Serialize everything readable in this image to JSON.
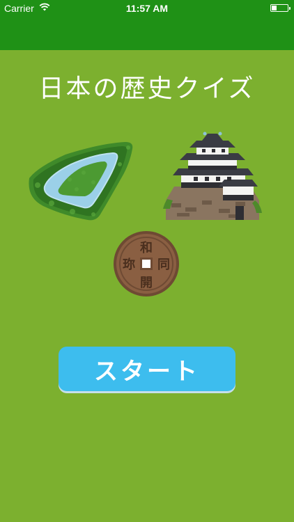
{
  "status_bar": {
    "carrier": "Carrier",
    "time": "11:57 AM",
    "wifi_icon": "wifi-icon",
    "battery_icon": "battery-icon"
  },
  "title": "日本の歴史クイズ",
  "illustrations": {
    "kofun": "kofun-illustration",
    "castle": "castle-illustration",
    "coin": "coin-illustration",
    "coin_characters": [
      "和",
      "同",
      "開",
      "珎"
    ]
  },
  "start_button": {
    "label": "スタート"
  },
  "colors": {
    "background": "#7cb02f",
    "nav_bar": "#1f9116",
    "button": "#3dbdee",
    "text": "#ffffff"
  }
}
